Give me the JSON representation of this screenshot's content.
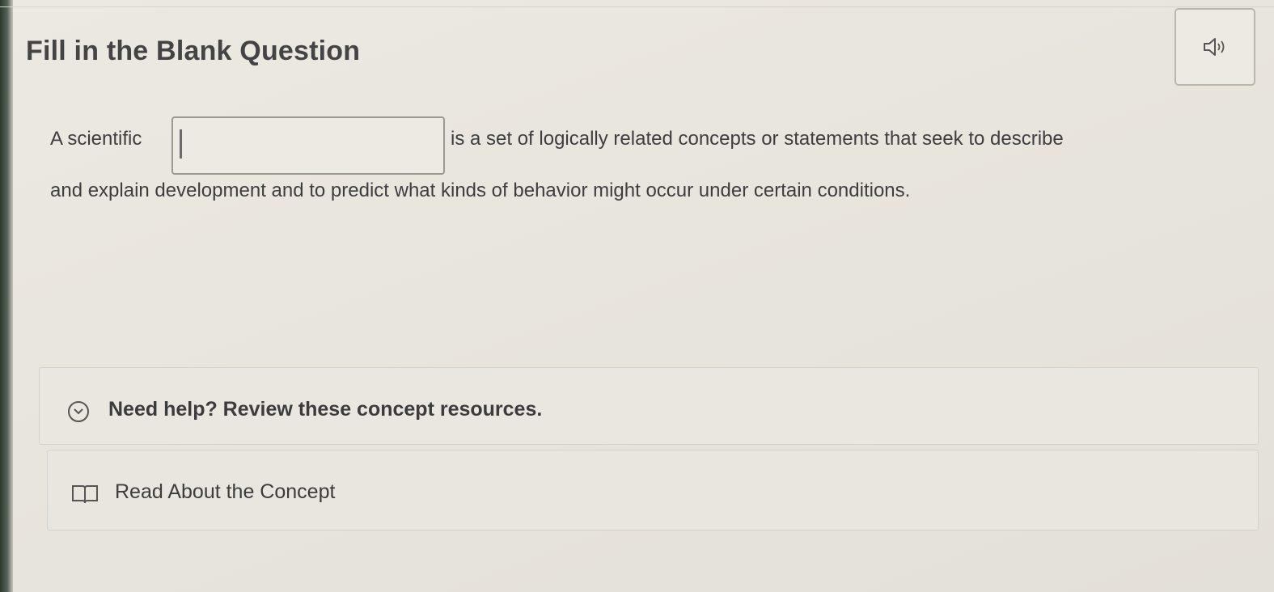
{
  "question": {
    "title": "Fill in the Blank Question",
    "text_before_blank": "A scientific",
    "text_after_blank": "is a set of logically related concepts or statements that seek to describe",
    "text_line2": "and explain development and to predict what kinds of behavior might occur under certain conditions.",
    "blank_value": ""
  },
  "icons": {
    "audio": "speaker-icon",
    "help_toggle": "chevron-down-circle-icon",
    "resource": "book-icon"
  },
  "help": {
    "label": "Need help? Review these concept resources."
  },
  "resources": [
    {
      "label": "Read About the Concept"
    }
  ]
}
